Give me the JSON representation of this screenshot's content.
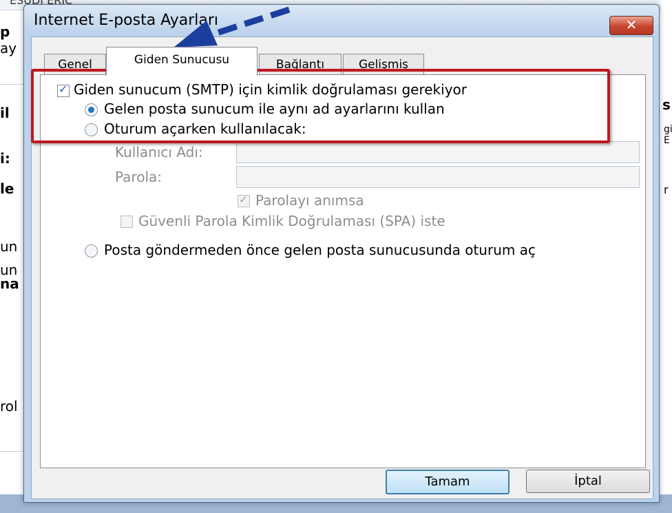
{
  "background": {
    "fragments": [
      "ESUDI ERIC",
      "p",
      "ay",
      "il",
      "i:",
      "le",
      "un",
      "un",
      "na",
      "rol",
      "s",
      "gi",
      "E",
      "r"
    ]
  },
  "dialog": {
    "title": "Internet E-posta Ayarları",
    "close_label": "✕",
    "tabs": [
      {
        "label": "Genel"
      },
      {
        "label": "Giden Sunucusu"
      },
      {
        "label": "Bağlantı"
      },
      {
        "label": "Gelişmiş"
      }
    ],
    "smtp_auth_label": "Giden sunucum (SMTP) için kimlik doğrulaması gerekiyor",
    "use_same_label": "Gelen posta sunucum ile aynı ad ayarlarını kullan",
    "logon_with_label": "Oturum açarken kullanılacak:",
    "username_label": "Kullanıcı Adı:",
    "username_value": "",
    "password_label": "Parola:",
    "password_value": "",
    "remember_password_label": "Parolayı anımsa",
    "spa_label": "Güvenli Parola Kimlik Doğrulaması (SPA) iste",
    "logon_before_label": "Posta göndermeden önce gelen posta sunucusunda oturum aç",
    "ok_label": "Tamam",
    "cancel_label": "İptal"
  },
  "state": {
    "smtp_auth_checked": true,
    "selected_radio": "use_same",
    "remember_password_checked": true,
    "spa_checked": false
  },
  "colors": {
    "highlight": "#c01720",
    "arrow": "#1c3f9e",
    "radio_selected": "#2a76c6"
  },
  "icons": [
    "close-icon",
    "checkbox-checked-icon",
    "radio-selected-icon",
    "radio-icon",
    "arrow-annotation-icon"
  ]
}
